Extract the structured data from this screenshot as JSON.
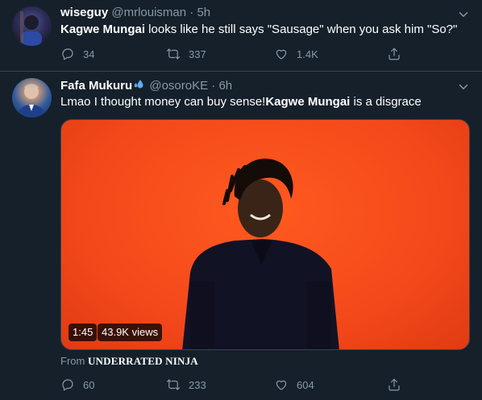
{
  "tweets": [
    {
      "display_name": "wiseguy",
      "handle": "@mrlouisman",
      "separator": "·",
      "time": "5h",
      "text_mention": "Kagwe Mungai",
      "text_rest": " looks like he still says \"Sausage\" when you ask him \"So?\"",
      "replies": "34",
      "retweets": "337",
      "likes": "1.4K"
    },
    {
      "display_name": "Fafa Mukuru",
      "handle": "@osoroKE",
      "separator": "·",
      "time": "6h",
      "text_before": "Lmao I thought money can buy sense!",
      "text_mention": "Kagwe Mungai",
      "text_after": " is a disgrace",
      "video": {
        "duration": "1:45",
        "views": "43.9K views"
      },
      "from_label": "From ",
      "from_source": "UNDERRATED NINJA",
      "replies": "60",
      "retweets": "233",
      "likes": "604"
    }
  ],
  "icons": {
    "reply": "reply-icon",
    "retweet": "retweet-icon",
    "like": "heart-icon",
    "share": "share-icon",
    "more": "chevron-down-icon",
    "emoji": "sweat-droplets-icon"
  },
  "colors": {
    "background": "#15202b",
    "muted": "#8899a6",
    "divider": "#38444d",
    "video_bg": "#f4491b",
    "emoji_blue": "#5dadec"
  }
}
